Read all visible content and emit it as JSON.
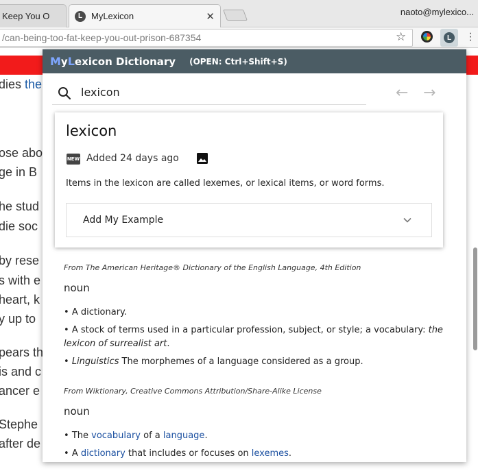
{
  "browser": {
    "tabs": [
      {
        "title": "Keep You O",
        "active": false
      },
      {
        "title": "MyLexicon",
        "active": true,
        "favicon": "L"
      }
    ],
    "user": "naoto@mylexico...",
    "url": "/can-being-too-fat-keep-you-out-prison-687354"
  },
  "background_page": {
    "lines": [
      "dies ",
      "ose abo",
      "ge in B",
      "he stud",
      " die soc",
      "by rese",
      "s with e",
      "heart, k",
      "y up to",
      "pears th",
      "is and c",
      "ancer e",
      "Stephe",
      "after de"
    ],
    "link_fragment": "thela"
  },
  "popup": {
    "brand": {
      "my_m": "M",
      "my_y": "y",
      "lex_l": "L",
      "rest": "exicon Dictionary"
    },
    "shortcut_hint": "(OPEN: Ctrl+Shift+S)",
    "search_value": "lexicon",
    "card": {
      "word": "lexicon",
      "badge": "NEW",
      "added": "Added 24 days ago",
      "definition": "Items in the lexicon are called lexemes, or lexical items, or word forms.",
      "example_label": "Add My Example"
    },
    "entries": [
      {
        "source": "From The American Heritage® Dictionary of the English Language, 4th Edition",
        "pos": "noun",
        "senses": [
          {
            "bullet": "• ",
            "text": "A dictionary."
          },
          {
            "bullet": "• ",
            "text": "A stock of terms used in a particular profession, subject, or style; a vocabulary: ",
            "italic": "the lexicon of surrealist art",
            "after": "."
          },
          {
            "bullet": "• ",
            "italic_lead": "Linguistics",
            "text": " The morphemes of a language considered as a group."
          }
        ]
      },
      {
        "source": "From Wiktionary, Creative Commons Attribution/Share-Alike License",
        "pos": "noun",
        "senses": [
          {
            "bullet": "• ",
            "pre": "The ",
            "link1": "vocabulary",
            "mid": " of a ",
            "link2": "language",
            "post": "."
          },
          {
            "bullet": "• ",
            "pre": "A ",
            "link1": "dictionary",
            "mid": " that includes or focuses on ",
            "link2": "lexemes",
            "post": "."
          }
        ]
      }
    ]
  },
  "colors": {
    "header": "#4b5c64",
    "brand_accent": "#7ea6ff",
    "link": "#1a4fa0",
    "bg_red": "#f21b1b"
  }
}
